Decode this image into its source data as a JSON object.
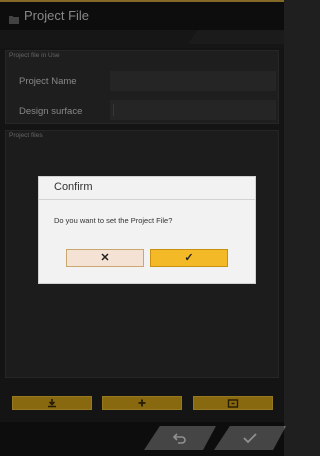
{
  "header": {
    "title": "Project File"
  },
  "project_in_use": {
    "title": "Project file in Use",
    "project_name_label": "Project Name",
    "project_name_value": "",
    "design_surface_label": "Design surface",
    "design_surface_value": ""
  },
  "project_files": {
    "title": "Project files"
  },
  "toolbar": {
    "buttons": [
      {
        "icon": "download-icon"
      },
      {
        "icon": "plus-icon"
      },
      {
        "icon": "folder-icon"
      }
    ]
  },
  "navigation": {
    "back_icon": "undo-icon",
    "ok_icon": "check-icon"
  },
  "dialog": {
    "title": "Confirm",
    "message": "Do you want to set the Project File?",
    "cancel_glyph": "✕",
    "ok_glyph": "✓"
  },
  "colors": {
    "accent": "#d3a219",
    "dialog_ok": "#f3b927",
    "dialog_cancel": "#f4e3d4"
  }
}
